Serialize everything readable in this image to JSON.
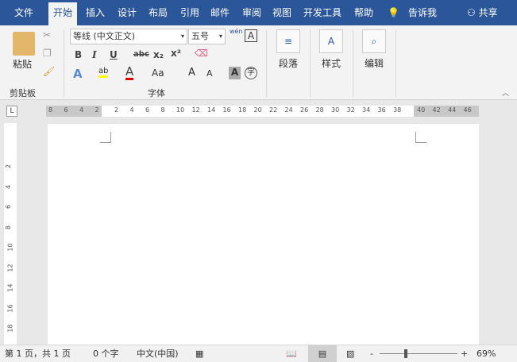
{
  "tabs": [
    {
      "label": "文件"
    },
    {
      "label": "开始",
      "active": true
    },
    {
      "label": "插入"
    },
    {
      "label": "设计"
    },
    {
      "label": "布局"
    },
    {
      "label": "引用"
    },
    {
      "label": "邮件"
    },
    {
      "label": "审阅"
    },
    {
      "label": "视图"
    },
    {
      "label": "开发工具"
    },
    {
      "label": "帮助"
    }
  ],
  "tell_me": "告诉我",
  "share": "共享",
  "clipboard": {
    "paste": "粘贴",
    "label": "剪贴板"
  },
  "font": {
    "name": "等线 (中文正文)",
    "size": "五号",
    "label": "字体",
    "bold": "B",
    "italic": "I",
    "underline": "U",
    "strike": "abc",
    "sub": "x₂",
    "sup": "x²",
    "case": "Aa",
    "phonetic": "wén",
    "grow": "A",
    "shrink": "A"
  },
  "paragraph": {
    "label": "段落"
  },
  "styles": {
    "label": "样式"
  },
  "editing": {
    "label": "编辑"
  },
  "ruler": {
    "left": [
      "8",
      "6",
      "4",
      "2"
    ],
    "main": [
      "2",
      "4",
      "6",
      "8",
      "10",
      "12",
      "14",
      "16",
      "18",
      "20",
      "22",
      "24",
      "26",
      "28",
      "30",
      "32",
      "34",
      "36",
      "38"
    ],
    "right": [
      "40",
      "42",
      "44",
      "46"
    ],
    "vertical": [
      "2",
      "4",
      "6",
      "8",
      "10",
      "12",
      "14",
      "16",
      "18"
    ]
  },
  "status": {
    "page": "第 1 页，共 1 页",
    "words": "0 个字",
    "lang": "中文(中国)",
    "zoom": "69%",
    "zoom_minus": "-",
    "zoom_plus": "+"
  },
  "colors": {
    "accent": "#2b579a",
    "highlight": "#ffff00",
    "font_color": "#e00000"
  }
}
